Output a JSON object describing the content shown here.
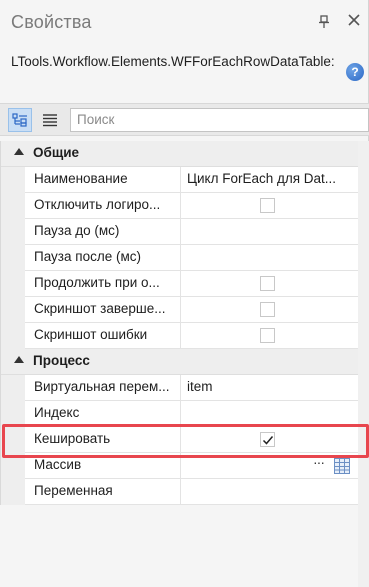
{
  "window": {
    "title": "Свойства",
    "pin_icon": "pin-icon",
    "close_icon": "close-icon"
  },
  "object_type": "LTools.Workflow.Elements.WFForEachRowDataTable:",
  "help_icon_label": "?",
  "toolbar": {
    "categorized_icon": "categorized-view-icon",
    "alphabetical_icon": "alphabetical-view-icon",
    "search_placeholder": "Поиск"
  },
  "categories": [
    {
      "name": "Общие",
      "properties": [
        {
          "name": "Наименование",
          "value": "Цикл  ForEach  для  Dat...",
          "type": "text"
        },
        {
          "name": "Отключить логиро...",
          "type": "checkbox",
          "checked": false
        },
        {
          "name": "Пауза до (мс)",
          "value": "",
          "type": "text"
        },
        {
          "name": "Пауза после (мс)",
          "value": "",
          "type": "text"
        },
        {
          "name": "Продолжить при о...",
          "type": "checkbox",
          "checked": false
        },
        {
          "name": "Скриншот заверше...",
          "type": "checkbox",
          "checked": false
        },
        {
          "name": "Скриншот ошибки",
          "type": "checkbox",
          "checked": false
        }
      ]
    },
    {
      "name": "Процесс",
      "properties": [
        {
          "name": "Виртуальная перем...",
          "value": "item",
          "type": "text"
        },
        {
          "name": "Индекс",
          "value": "",
          "type": "text"
        },
        {
          "name": "Кешировать",
          "type": "checkbox",
          "checked": true
        },
        {
          "name": "Массив",
          "type": "editor",
          "button_label": "···",
          "icon": "table-icon"
        },
        {
          "name": "Переменная",
          "value": "",
          "type": "text"
        }
      ]
    }
  ],
  "colors": {
    "highlight": "#e8464e",
    "help_badge": "#2a67c5",
    "toolbar_active": "#c9def5"
  }
}
